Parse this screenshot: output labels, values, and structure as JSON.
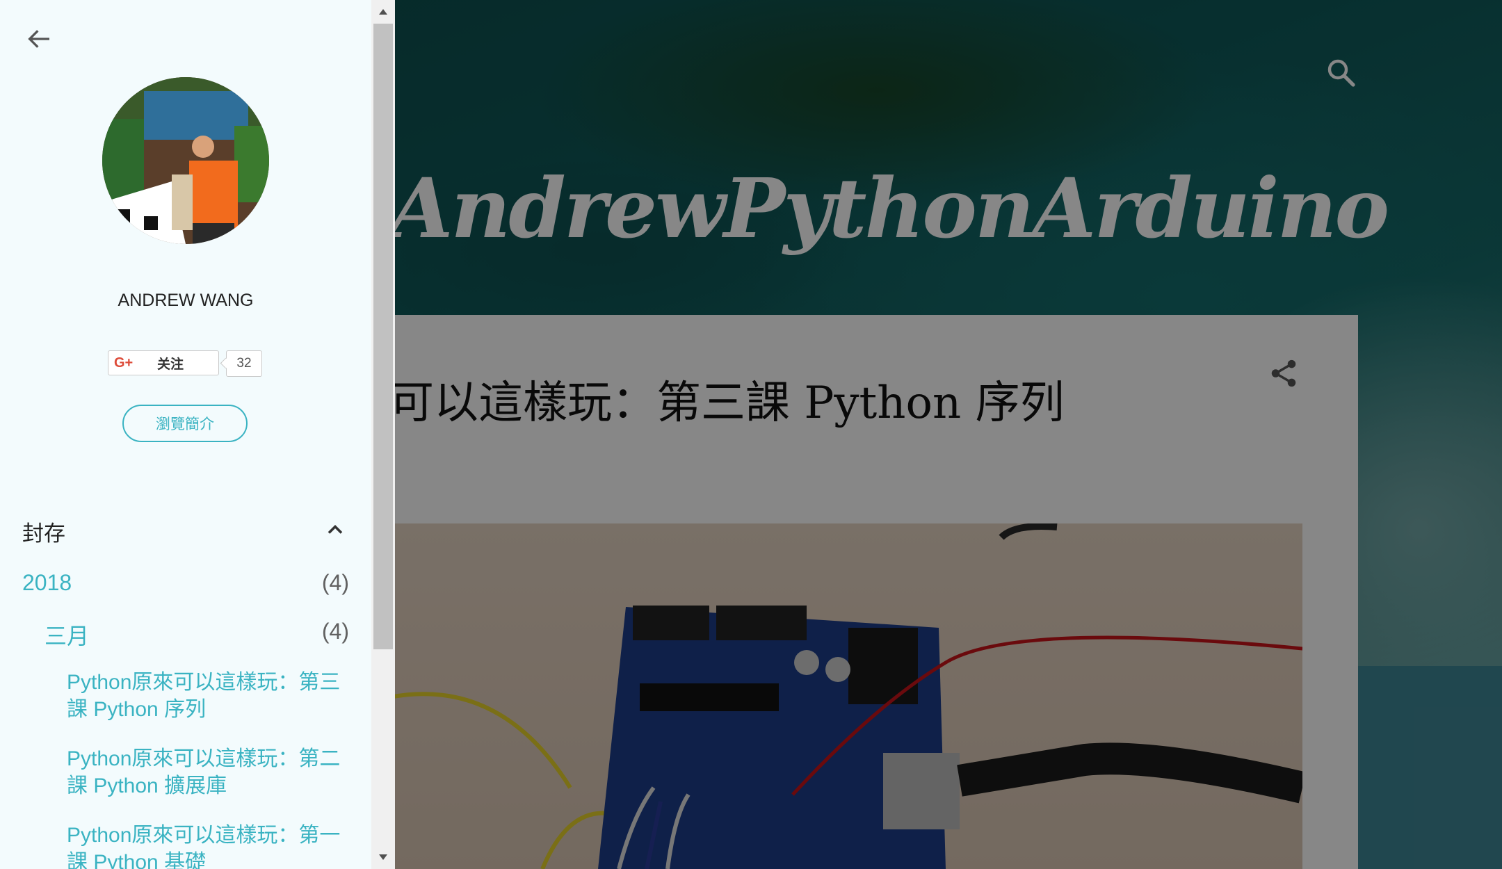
{
  "blog": {
    "title": "AndrewPythonArduino",
    "post_title": "可以這樣玩：第三課 Python 序列"
  },
  "drawer": {
    "profile_name": "ANDREW WANG",
    "gplus": {
      "logo": "G+",
      "follow_label": "关注",
      "count": "32"
    },
    "browse_profile_label": "瀏覽簡介",
    "archive": {
      "title": "封存",
      "year": {
        "label": "2018",
        "count": "(4)"
      },
      "month": {
        "label": "三月",
        "count": "(4)"
      },
      "posts": [
        "Python原來可以這樣玩：第三課 Python 序列",
        "Python原來可以這樣玩：第二課 Python 擴展庫",
        "Python原來可以這樣玩：第一課 Python 基礎"
      ]
    }
  },
  "icons": {
    "back": "arrow-back-icon",
    "search": "search-icon",
    "share": "share-icon",
    "collapse": "chevron-up-icon"
  },
  "colors": {
    "accent": "#3ab3c2",
    "drawer_bg": "#f3fbfd",
    "gplus_red": "#dd4b39"
  }
}
